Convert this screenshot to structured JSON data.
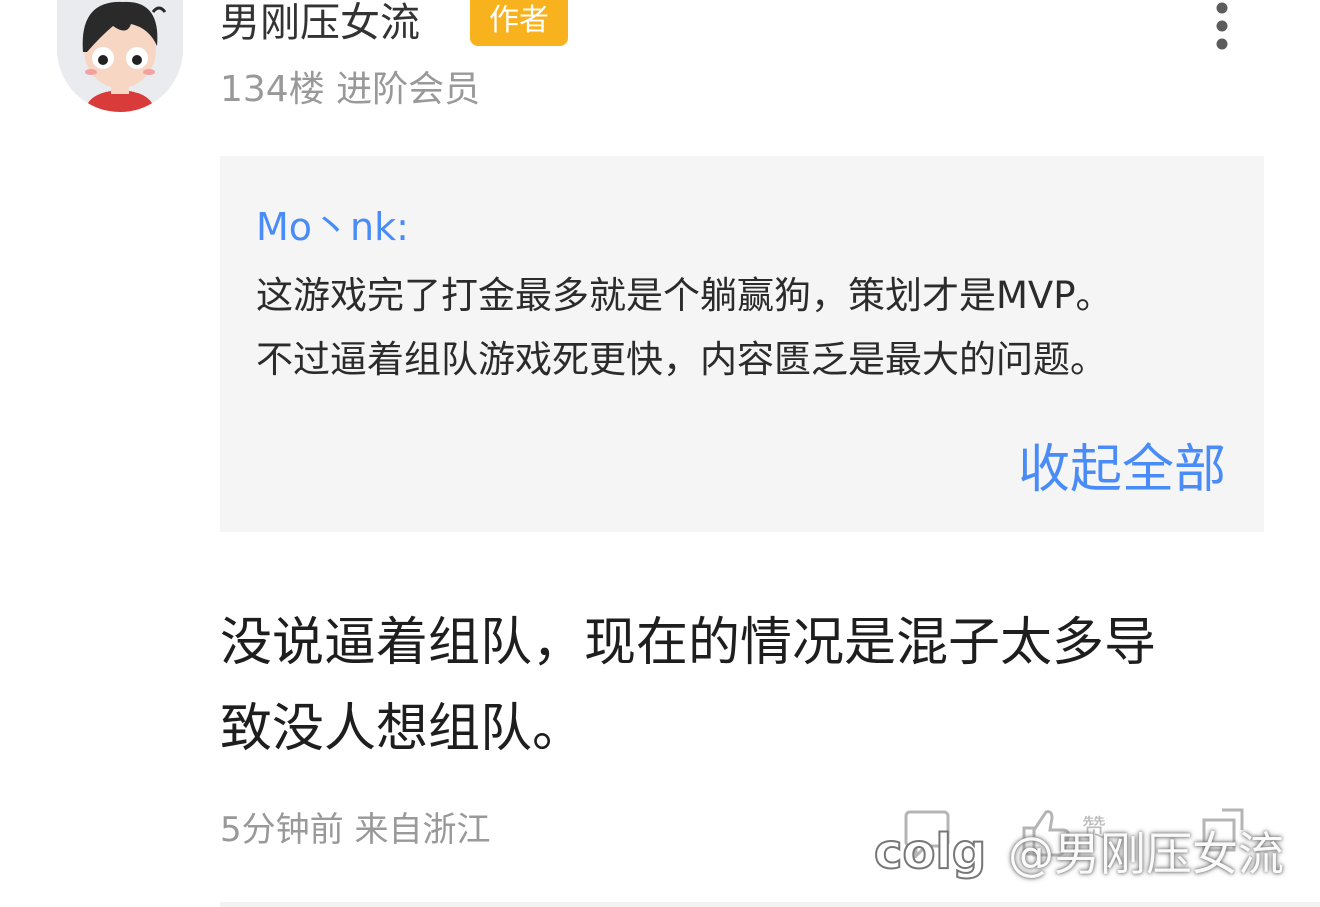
{
  "post": {
    "author": {
      "name": "男刚压女流",
      "badge": "作者",
      "floor": "134楼",
      "level": "进阶会员"
    },
    "quote": {
      "user": "Mo丶nk:",
      "lines": [
        "这游戏完了打金最多就是个躺赢狗，策划才是MVP。",
        "不过逼着组队游戏死更快，内容匮乏是最大的问题。"
      ],
      "collapse_label": "收起全部"
    },
    "reply_lines": [
      "没说逼着组队，现在的情况是混子太多导",
      "致没人想组队。"
    ],
    "time": "5分钟前",
    "location": "来自浙江",
    "actions": {
      "like_label": "赞"
    }
  },
  "watermark": {
    "logo_text": "colg",
    "text": "@男刚压女流"
  },
  "icons": {
    "avatar": "cartoon-avatar",
    "more": "more-vertical-icon",
    "reply": "reply-icon",
    "like": "thumb-up-icon",
    "share": "share-icon"
  },
  "colors": {
    "link": "#4a8cf7",
    "badge": "#f7b21e",
    "muted": "#999999",
    "quote_bg": "#f5f5f5"
  }
}
